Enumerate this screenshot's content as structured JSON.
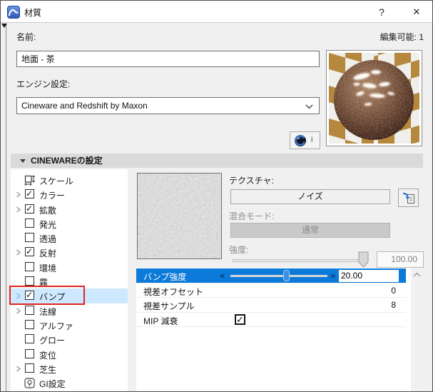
{
  "window": {
    "title": "材質",
    "help_label": "?",
    "close_label": "✕"
  },
  "name_row": {
    "label": "名前:",
    "value": "地面 - 茶",
    "editable_info": "編集可能: 1"
  },
  "engine": {
    "label": "エンジン設定:",
    "value": "Cineware and Redshift by Maxon"
  },
  "c4d_button": {
    "info_label": "i",
    "icon": "cinema4d-logo"
  },
  "section": {
    "title": "CINEWAREの設定"
  },
  "tree": {
    "items": [
      {
        "label": "スケール",
        "icon": "scale-icon",
        "expandable": false,
        "checkbox": false
      },
      {
        "label": "カラー",
        "expandable": true,
        "checkbox": true,
        "checked": true
      },
      {
        "label": "拡散",
        "expandable": true,
        "checkbox": true,
        "checked": true
      },
      {
        "label": "発光",
        "expandable": false,
        "checkbox": true,
        "checked": false
      },
      {
        "label": "透過",
        "expandable": false,
        "checkbox": true,
        "checked": false
      },
      {
        "label": "反射",
        "expandable": true,
        "checkbox": true,
        "checked": true
      },
      {
        "label": "環境",
        "expandable": false,
        "checkbox": true,
        "checked": false
      },
      {
        "label": "霧",
        "expandable": false,
        "checkbox": true,
        "checked": false
      },
      {
        "label": "バンプ",
        "expandable": true,
        "checkbox": true,
        "checked": true,
        "selected": true,
        "annotated": true
      },
      {
        "label": "法線",
        "expandable": true,
        "checkbox": true,
        "checked": false
      },
      {
        "label": "アルファ",
        "expandable": false,
        "checkbox": true,
        "checked": false
      },
      {
        "label": "グロー",
        "expandable": false,
        "checkbox": true,
        "checked": false
      },
      {
        "label": "変位",
        "expandable": false,
        "checkbox": true,
        "checked": false
      },
      {
        "label": "芝生",
        "expandable": true,
        "checkbox": true,
        "checked": false
      },
      {
        "label": "GI設定",
        "icon": "gi-settings-icon",
        "expandable": false,
        "checkbox": false
      }
    ]
  },
  "texture_panel": {
    "texture_label": "テクスチャ:",
    "texture_button": "ノイズ",
    "assign_icon": "load-texture-icon",
    "blend_label": "混合モード:",
    "blend_button": "通常",
    "strength_label": "強度:",
    "strength_value": "100.00"
  },
  "bump_table": {
    "rows": [
      {
        "label": "バンプ強度",
        "value": "20.00",
        "chevron_left": "«",
        "chevron_right": "»",
        "selected": true
      },
      {
        "label": "視差オフセット",
        "value": "0"
      },
      {
        "label": "視差サンプル",
        "value": "8"
      },
      {
        "label": "MIP 減衰",
        "checked": true
      }
    ]
  },
  "colors": {
    "selection_blue": "#0b7ad9",
    "tree_selection": "#cde8ff",
    "annotation_red": "#e32220",
    "titlebar": "#ffffff",
    "dialog_bg": "#f0f0f0"
  }
}
